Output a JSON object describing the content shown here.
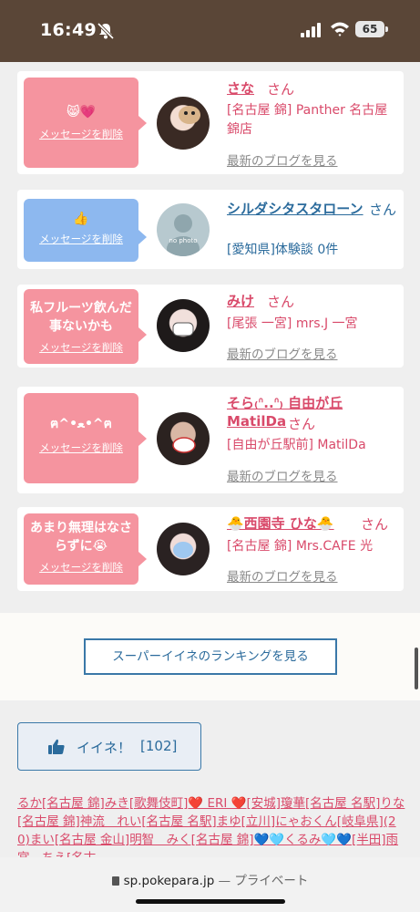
{
  "status": {
    "time": "16:49",
    "battery": "65"
  },
  "cards": [
    {
      "bubble_color": "pink",
      "message": "😸💗",
      "delete_label": "メッセージを削除",
      "name": "さな",
      "suffix": "さん",
      "shop": "[名古屋 錦] Panther 名古屋錦店",
      "blog_label": "最新のブログを見る",
      "avatar": "avatar-photo"
    },
    {
      "bubble_color": "blue",
      "message": "👍",
      "delete_label": "メッセージを削除",
      "name": "シルダシタスタローン",
      "suffix": "さん",
      "shop": "[愛知県]体験談 0件",
      "avatar": "no-photo",
      "avatar_text": "no photo"
    },
    {
      "bubble_color": "pink",
      "message": "私フルーツ飲んだ事ないかも",
      "delete_label": "メッセージを削除",
      "name": "みけ",
      "suffix": "さん",
      "shop": "[尾張 一宮] mrs.J 一宮",
      "blog_label": "最新のブログを見る",
      "avatar": "avatar-photo"
    },
    {
      "bubble_color": "pink",
      "message": "ฅ^•ﻌ•^ฅ",
      "delete_label": "メッセージを削除",
      "name": "そら₍ᐢ..ᐢ₎ 自由が丘MatilDa",
      "suffix": "さん",
      "shop": "[自由が丘駅前] MatilDa",
      "blog_label": "最新のブログを見る",
      "avatar": "avatar-photo"
    },
    {
      "bubble_color": "pink",
      "message": "あまり無理はなさらずに😭",
      "delete_label": "メッセージを削除",
      "name": "🐣西園寺 ひな🐣",
      "suffix": "さん",
      "shop": "[名古屋 錦] Mrs.CAFE 光",
      "blog_label": "最新のブログを見る",
      "avatar": "avatar-photo"
    }
  ],
  "ranking_button": "スーパーイイネのランキングを見る",
  "like_button": {
    "label": "イイネ！",
    "count": "[102]"
  },
  "likers": [
    "るか[名古屋 錦]",
    "みき[歌舞伎町]",
    "❤️ ERI ❤️[安城]",
    "瓊華[名古屋 名駅]",
    "りな[名古屋 錦]",
    "神流　れい[名古屋 名駅]",
    "まゆ[立川]",
    "にゃおくん[岐阜県](20)",
    "まい[名古屋 金山]",
    "明智　みく[名古屋 錦]",
    "💙🩵くるみ🩵💙[半田]",
    "雨宮　ちえ[名古"
  ],
  "browser": {
    "url": "sp.pokepara.jp",
    "mode": "— プライベート"
  }
}
